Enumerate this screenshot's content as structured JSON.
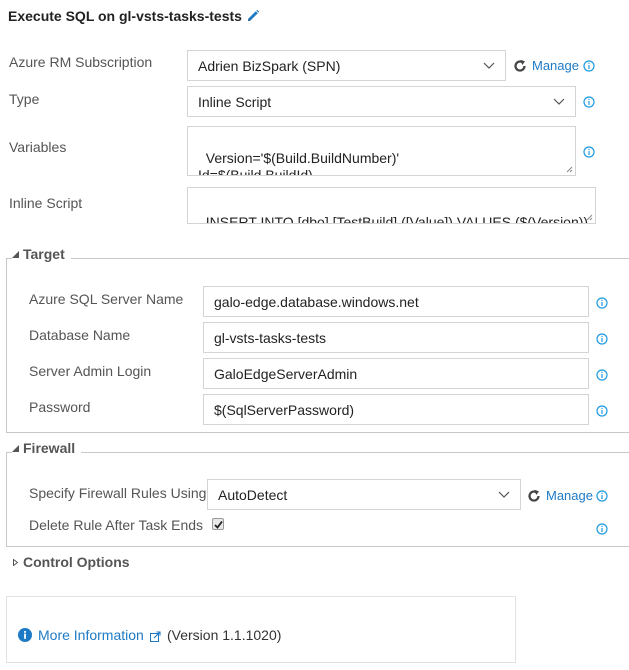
{
  "header": {
    "title": "Execute SQL on gl-vsts-tasks-tests",
    "edit_icon": "pencil-icon"
  },
  "colors": {
    "accent": "#1e7ac4",
    "info_icon": "#1e9be0",
    "border": "#d4d4d4",
    "label": "#555555"
  },
  "main_fields": {
    "subscription": {
      "label": "Azure RM Subscription",
      "value": "Adrien BizSpark (SPN)",
      "manage_label": "Manage",
      "icons": [
        "chevron-down-icon",
        "refresh-icon",
        "info-icon"
      ]
    },
    "type": {
      "label": "Type",
      "value": "Inline Script",
      "icons": [
        "chevron-down-icon",
        "info-icon"
      ]
    },
    "variables": {
      "label": "Variables",
      "value": "Version='$(Build.BuildNumber)'\nId=$(Build.BuildId)",
      "icons": [
        "info-icon"
      ]
    },
    "inline_script": {
      "label": "Inline Script",
      "value": "INSERT INTO [dbo].[TestBuild] ([Value]) VALUES ($(Version))"
    }
  },
  "target": {
    "heading": "Target",
    "expanded": true,
    "fields": [
      {
        "label": "Azure SQL Server Name",
        "value": "galo-edge.database.windows.net"
      },
      {
        "label": "Database Name",
        "value": "gl-vsts-tasks-tests"
      },
      {
        "label": "Server Admin Login",
        "value": "GaloEdgeServerAdmin"
      },
      {
        "label": "Password",
        "value": "$(SqlServerPassword)"
      }
    ]
  },
  "firewall": {
    "heading": "Firewall",
    "expanded": true,
    "rules_label": "Specify Firewall Rules Using",
    "rules_value": "AutoDetect",
    "manage_label": "Manage",
    "delete_rule_label": "Delete Rule After Task Ends",
    "delete_rule_checked": true
  },
  "control_options": {
    "heading": "Control Options",
    "expanded": false
  },
  "footer": {
    "more_info_label": "More Information",
    "version_text": "(Version 1.1.1020)"
  }
}
